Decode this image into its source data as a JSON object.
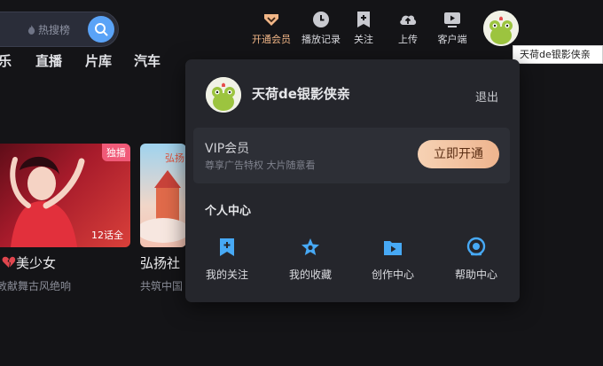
{
  "search": {
    "hot_label": "热搜榜"
  },
  "nav": [
    {
      "label": "开通会员",
      "icon": "vip-heart-icon"
    },
    {
      "label": "播放记录",
      "icon": "clock-icon"
    },
    {
      "label": "关注",
      "icon": "bookmark-plus-icon"
    },
    {
      "label": "上传",
      "icon": "cloud-upload-icon"
    },
    {
      "label": "客户端",
      "icon": "tv-play-icon"
    }
  ],
  "user": {
    "tooltip": "天荷de银影侠亲"
  },
  "categories": [
    "乐",
    "直播",
    "片库",
    "汽车"
  ],
  "cards": [
    {
      "badge": "独播",
      "count": "12话全",
      "title": "美少女",
      "subtitle": "敦献舞古风绝响"
    },
    {
      "title": "弘扬社",
      "subtitle": "共筑中国"
    }
  ],
  "dropdown": {
    "username": "天荷de银影侠亲",
    "logout": "退出",
    "vip": {
      "title": "VIP会员",
      "desc": "尊享广告特权 大片随意看",
      "button": "立即开通"
    },
    "center_title": "个人中心",
    "items": [
      {
        "label": "我的关注",
        "icon": "bookmark-plus-icon"
      },
      {
        "label": "我的收藏",
        "icon": "star-icon"
      },
      {
        "label": "创作中心",
        "icon": "folder-play-icon"
      },
      {
        "label": "帮助中心",
        "icon": "headset-icon"
      }
    ]
  },
  "colors": {
    "background": "#141417",
    "panel": "#25262c",
    "vip_accent": "#f1b687",
    "search_button": "#5aa3f7",
    "center_icon": "#47a9f5",
    "badge": "#f05a78"
  }
}
